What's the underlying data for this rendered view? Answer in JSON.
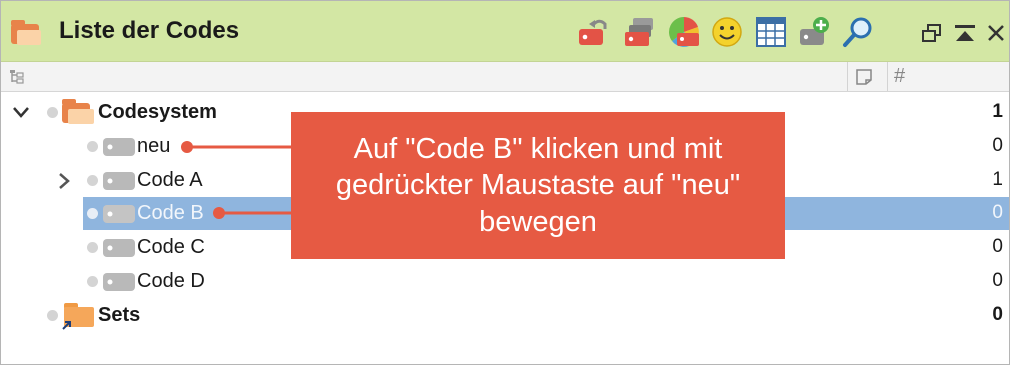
{
  "window": {
    "title": "Liste der Codes"
  },
  "toolbar": {
    "icons": [
      "undo-code-icon",
      "code-sets-icon",
      "color-codes-icon",
      "emoticode-icon",
      "table-icon",
      "new-code-icon",
      "search-icon"
    ],
    "window_controls": [
      "undock-icon",
      "collapse-icon",
      "close-icon"
    ]
  },
  "columns": {
    "memo_icon": "memo-column-icon",
    "count_symbol": "#"
  },
  "tree": {
    "root": {
      "label": "Codesystem",
      "count": "1"
    },
    "codes": [
      {
        "label": "neu",
        "count": "0"
      },
      {
        "label": "Code A",
        "count": "1"
      },
      {
        "label": "Code B",
        "count": "0",
        "selected": true
      },
      {
        "label": "Code C",
        "count": "0"
      },
      {
        "label": "Code D",
        "count": "0"
      }
    ],
    "sets": {
      "label": "Sets",
      "count": "0"
    }
  },
  "callout": {
    "text": "Auf \"Code B\" klicken und mit gedrückter Maustaste auf \"neu\" bewegen"
  },
  "colors": {
    "title_bar": "#d3e7a4",
    "selection": "#8fb5de",
    "callout": "#e65a43",
    "folder": "#f09a44"
  }
}
